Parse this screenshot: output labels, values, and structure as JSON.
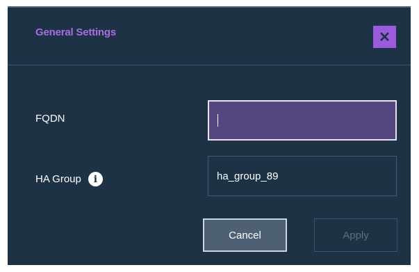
{
  "dialog": {
    "title": "General Settings",
    "close_label": "✕"
  },
  "fields": {
    "fqdn": {
      "label": "FQDN",
      "value": ""
    },
    "ha_group": {
      "label": "HA Group",
      "value": "ha_group_89",
      "info_icon": "info-icon",
      "info_glyph": "i"
    }
  },
  "buttons": {
    "cancel_label": "Cancel",
    "apply_label": "Apply"
  },
  "colors": {
    "dialog_bg": "#1e3246",
    "accent": "#9a5cda",
    "focused_input_bg": "#544781"
  }
}
